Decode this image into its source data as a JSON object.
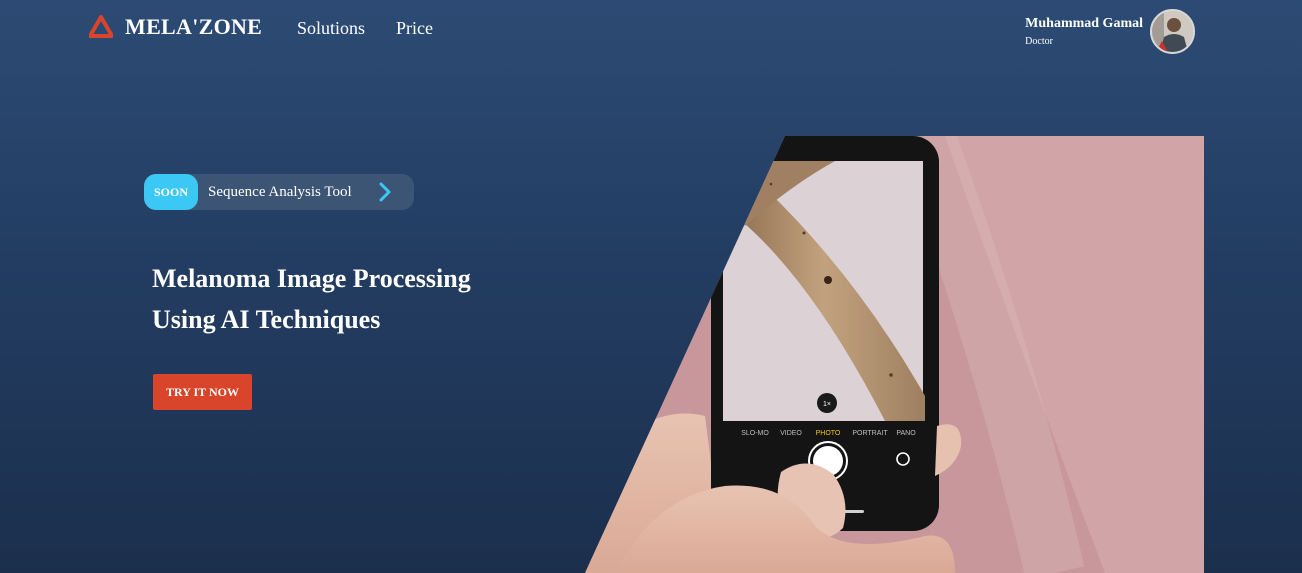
{
  "brand": {
    "name": "MELA'ZONE",
    "logo_icon": "triangle-logo-icon",
    "accent": "#d9452b"
  },
  "nav": {
    "links": [
      {
        "label": "Solutions"
      },
      {
        "label": "Price"
      }
    ]
  },
  "user": {
    "name": "Muhammad Gamal",
    "role": "Doctor"
  },
  "badge": {
    "tag": "SOON",
    "text": "Sequence Analysis Tool",
    "icon": "chevron-right-icon",
    "tag_color": "#3cc8f5"
  },
  "hero": {
    "line1": "Melanoma Image Processing",
    "line2": "Using AI Techniques",
    "cta_label": "TRY IT NOW"
  },
  "phone": {
    "zoom": "1×",
    "modes": [
      "SLO-MO",
      "VIDEO",
      "PHOTO",
      "PORTRAIT",
      "PANO"
    ],
    "active_mode": "PHOTO"
  }
}
